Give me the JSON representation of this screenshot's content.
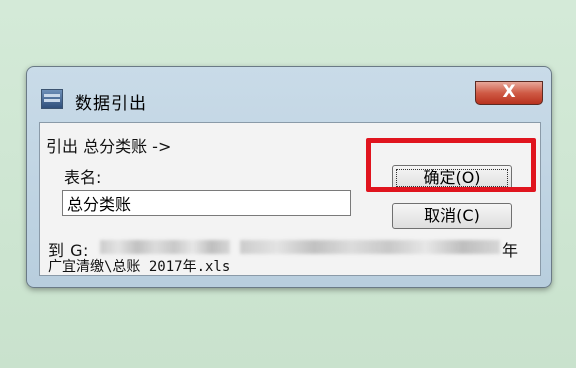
{
  "window": {
    "title": "数据引出",
    "close_label": "X"
  },
  "export": {
    "source_label": "引出 总分类账 ->",
    "table_name_label": "表名:",
    "table_name_value": "总分类账",
    "dest_prefix": "到 G:",
    "dest_suffix": "年",
    "dest_path_line2": "广宜清缴\\总账 2017年.xls"
  },
  "buttons": {
    "ok_label": "确定(O)",
    "cancel_label": "取消(C)"
  },
  "colors": {
    "highlight": "#e0141e",
    "close_button": "#c8412b"
  }
}
